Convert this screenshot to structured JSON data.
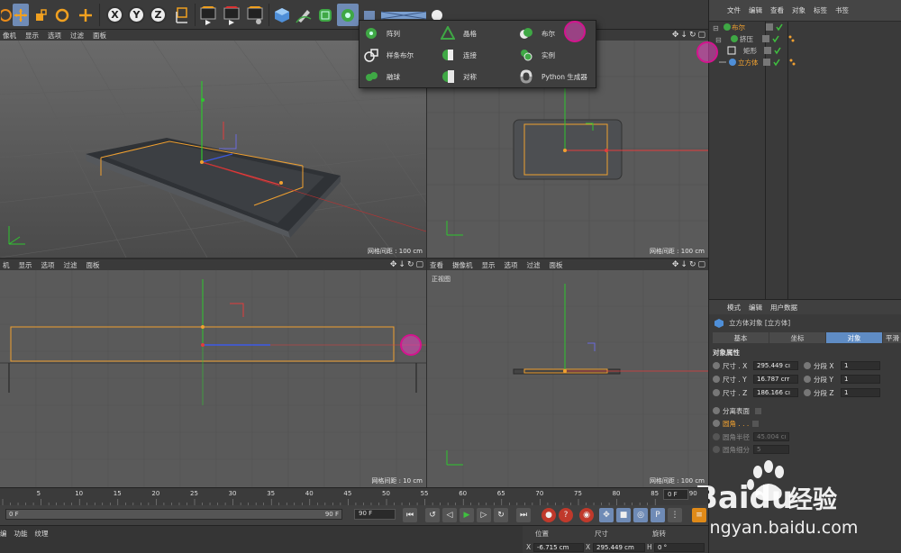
{
  "vp_menu_tl": [
    "像机",
    "显示",
    "选项",
    "过滤",
    "面板"
  ],
  "vp_menu_bl": [
    "机",
    "显示",
    "选项",
    "过滤",
    "面板"
  ],
  "vp_menu_br": [
    "查看",
    "摄像机",
    "显示",
    "选项",
    "过滤",
    "面板"
  ],
  "vp_tl": {
    "grid": "网格间距 : 100 cm"
  },
  "vp_tr": {
    "grid": "网格间距 : 100 cm"
  },
  "vp_bl": {
    "grid": "网格间距 : 10 cm"
  },
  "vp_br": {
    "label": "正视图",
    "grid": "网格间距 : 100 cm"
  },
  "popup": {
    "items": [
      {
        "label": "阵列",
        "icon": "array-icon"
      },
      {
        "label": "晶格",
        "icon": "atom-icon"
      },
      {
        "label": "布尔",
        "icon": "boole-icon"
      },
      {
        "label": "样条布尔",
        "icon": "spline-boole-icon"
      },
      {
        "label": "连接",
        "icon": "connect-icon"
      },
      {
        "label": "实例",
        "icon": "instance-icon"
      },
      {
        "label": "融球",
        "icon": "metaball-icon"
      },
      {
        "label": "对称",
        "icon": "symmetry-icon"
      },
      {
        "label": "Python 生成器",
        "icon": "python-icon"
      }
    ]
  },
  "object_manager": {
    "menu": [
      "文件",
      "编辑",
      "查看",
      "对象",
      "标签",
      "书签"
    ],
    "objects": [
      {
        "name": "布尔"
      },
      {
        "name": "挤压"
      },
      {
        "name": "矩形"
      },
      {
        "name": "立方体"
      }
    ]
  },
  "attributes": {
    "menu": [
      "模式",
      "编辑",
      "用户数据"
    ],
    "title": "立方体对象 [立方体]",
    "tabs": [
      "基本",
      "坐标",
      "对象",
      "平滑"
    ],
    "section": "对象属性",
    "rows": [
      {
        "label": "尺寸 . X",
        "value": "295.449 cı",
        "seg_label": "分段 X",
        "seg_value": "1"
      },
      {
        "label": "尺寸 . Y",
        "value": "16.787 crr",
        "seg_label": "分段 Y",
        "seg_value": "1"
      },
      {
        "label": "尺寸 . Z",
        "value": "186.166 cı",
        "seg_label": "分段 Z",
        "seg_value": "1"
      }
    ],
    "separate": "分离表面",
    "fillet": "圆角 . . .",
    "fillet_radius_label": "圆角半径",
    "fillet_radius": "45.004 cı",
    "fillet_sub_label": "圆角细分",
    "fillet_sub": "5"
  },
  "timeline": {
    "ticks": [
      "5",
      "10",
      "15",
      "20",
      "25",
      "30",
      "35",
      "40",
      "45",
      "50",
      "55",
      "60",
      "65",
      "70",
      "75",
      "80",
      "85",
      "90"
    ],
    "current_frame": "0 F",
    "start": "0 F",
    "end": "90 F",
    "end_field": "90 F"
  },
  "bottom": {
    "tabs": [
      "编",
      "功能",
      "纹理"
    ],
    "coord_headers": [
      "位置",
      "尺寸",
      "旋转"
    ],
    "x_pos": "-6.715 cm",
    "x_size": "295.449 cm",
    "h_rot": "0 °",
    "x_label": "X",
    "x2_label": "X",
    "h_label": "H"
  },
  "watermark": {
    "brand": "Baidu",
    "cn": "经验",
    "url": "jingyan.baidu.com"
  },
  "colors": {
    "accent_blue": "#6f8bb6",
    "selection_orange": "#f0a030",
    "highlight_magenta": "#e246be"
  }
}
